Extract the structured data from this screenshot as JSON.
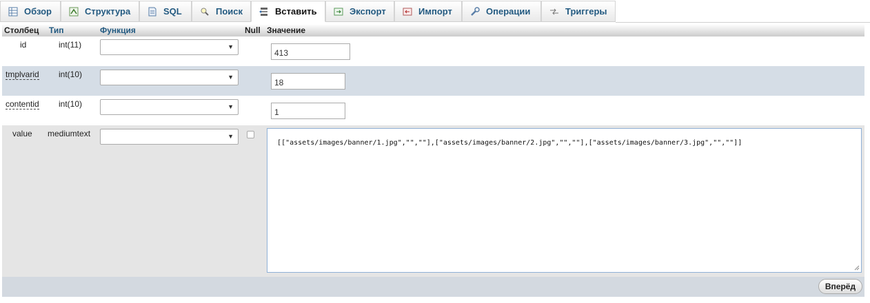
{
  "tabs": [
    {
      "label": "Обзор",
      "icon": "table-browse-icon"
    },
    {
      "label": "Структура",
      "icon": "structure-icon"
    },
    {
      "label": "SQL",
      "icon": "sql-icon"
    },
    {
      "label": "Поиск",
      "icon": "search-icon"
    },
    {
      "label": "Вставить",
      "icon": "insert-icon"
    },
    {
      "label": "Экспорт",
      "icon": "export-icon"
    },
    {
      "label": "Импорт",
      "icon": "import-icon"
    },
    {
      "label": "Операции",
      "icon": "wrench-icon"
    },
    {
      "label": "Триггеры",
      "icon": "triggers-icon"
    }
  ],
  "active_tab": "Вставить",
  "headers": {
    "column": "Столбец",
    "type": "Тип",
    "function": "Функция",
    "null": "Null",
    "value": "Значение"
  },
  "rows": [
    {
      "name": "id",
      "type": "int(11)",
      "function": "",
      "value": "413"
    },
    {
      "name": "tmplvarid",
      "type": "int(10)",
      "function": "",
      "value": "18"
    },
    {
      "name": "contentid",
      "type": "int(10)",
      "function": "",
      "value": "1"
    },
    {
      "name": "value",
      "type": "mediumtext",
      "function": "",
      "null_checked": false,
      "value": "[[\"assets/images/banner/1.jpg\",\"\",\"\"],[\"assets/images/banner/2.jpg\",\"\",\"\"],[\"assets/images/banner/3.jpg\",\"\",\"\"]]"
    }
  ],
  "submit_label": "Вперёд",
  "colors": {
    "link": "#235a81",
    "alt_row": "#d5dde6",
    "text_row": "#e5e5e5"
  }
}
